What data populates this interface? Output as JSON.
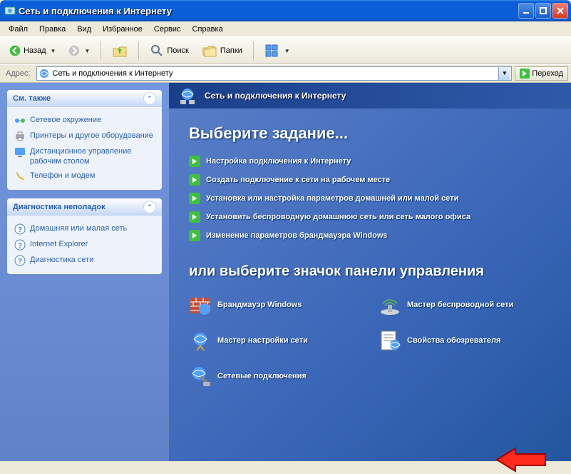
{
  "window": {
    "title": "Сеть и подключения к Интернету"
  },
  "menu": {
    "file": "Файл",
    "edit": "Правка",
    "view": "Вид",
    "favorites": "Избранное",
    "tools": "Сервис",
    "help": "Справка"
  },
  "toolbar": {
    "back": "Назад",
    "search": "Поиск",
    "folders": "Папки"
  },
  "addressbar": {
    "label": "Адрес:",
    "value": "Сеть и подключения к Интернету",
    "go": "Переход"
  },
  "leftpanel": {
    "seealso": {
      "title": "См. также",
      "items": [
        "Сетевое окружение",
        "Принтеры и другое оборудование",
        "Дистанционное управление рабочим столом",
        "Телефон и модем"
      ]
    },
    "troubleshoot": {
      "title": "Диагностика неполадок",
      "items": [
        "Домашняя или малая сеть",
        "Internet Explorer",
        "Диагностика сети"
      ]
    }
  },
  "rightheader": {
    "title": "Сеть и подключения к Интернету"
  },
  "content": {
    "taskTitle": "Выберите задание...",
    "tasks": [
      "Настройка подключения к Интернету",
      "Создать подключение к сети на рабочем месте",
      "Установка или настройка параметров домашней или малой сети",
      "Установить беспроводную домашнюю сеть или сеть малого офиса",
      "Изменение параметров брандмауэра Windows"
    ],
    "cpTitle": "или выберите значок панели управления",
    "cpItems": [
      "Брандмауэр Windows",
      "Мастер беспроводной сети",
      "Мастер настройки сети",
      "Свойства обозревателя",
      "Сетевые подключения"
    ]
  }
}
